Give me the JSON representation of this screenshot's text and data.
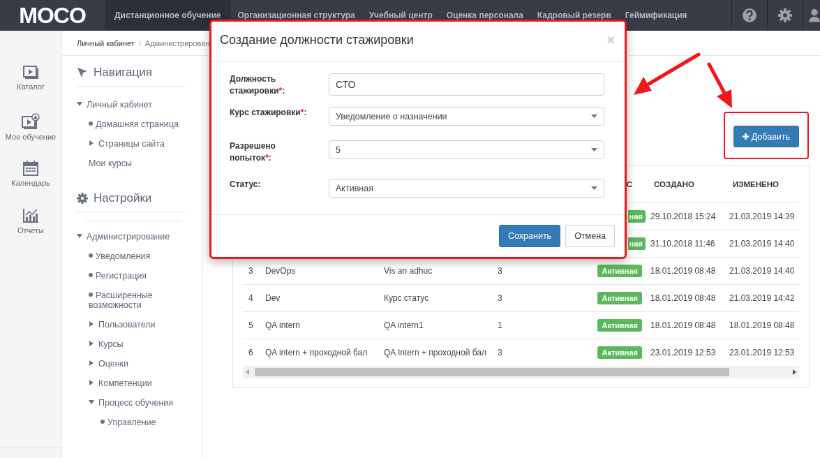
{
  "logo": "MOCO",
  "top_menu": [
    {
      "label": "Дистанционное обучение",
      "selected": true
    },
    {
      "label": "Организационная структура",
      "selected": false
    },
    {
      "label": "Учебный центр",
      "selected": false
    },
    {
      "label": "Оценка персонала",
      "selected": false
    },
    {
      "label": "Кадровый резерв",
      "selected": false
    },
    {
      "label": "Геймификация",
      "selected": false
    }
  ],
  "rail": [
    {
      "label": "Каталог"
    },
    {
      "label": "Мое обучение"
    },
    {
      "label": "Календарь"
    },
    {
      "label": "Отчеты"
    }
  ],
  "breadcrumb": [
    {
      "label": "Личный кабинет"
    },
    {
      "separator": "/",
      "label": "Администрирован"
    }
  ],
  "sections": [
    {
      "title": "Навигация",
      "items": [
        {
          "label": "Личный кабинет",
          "kind": "folder",
          "expanded": true,
          "children": [
            {
              "label": "Домашняя страница",
              "kind": "leaf"
            },
            {
              "label": "Страницы сайта",
              "kind": "folder",
              "expanded": false
            }
          ]
        },
        {
          "label": "Мои курсы",
          "kind": "plain"
        }
      ]
    },
    {
      "title": "Настройки",
      "items": [
        {
          "label": "Администрирование",
          "kind": "folder",
          "expanded": true,
          "children": [
            {
              "label": "Уведомления",
              "kind": "leaf"
            },
            {
              "label": "Регистрация",
              "kind": "leaf"
            },
            {
              "label": "Расширенные возможности",
              "kind": "leaf"
            },
            {
              "label": "Пользователи",
              "kind": "folder",
              "expanded": false
            },
            {
              "label": "Курсы",
              "kind": "folder",
              "expanded": false
            },
            {
              "label": "Оценки",
              "kind": "folder",
              "expanded": false
            },
            {
              "label": "Компетенции",
              "kind": "folder",
              "expanded": false
            },
            {
              "label": "Процесс обучения",
              "kind": "folder",
              "expanded": true,
              "children": [
                {
                  "label": "Управление",
                  "kind": "leaf"
                }
              ]
            }
          ]
        }
      ]
    }
  ],
  "add_button": "Добавить",
  "table": {
    "header": {
      "status": "С",
      "created": "СОЗДАНО",
      "changed": "ИЗМЕНЕНО"
    },
    "rows": [
      {
        "status": "ная",
        "created": "29.10.2018 15:24",
        "changed": "21.03.2019 14:39"
      },
      {
        "status": "ная",
        "created": "31.10.2018 11:46",
        "changed": "21.03.2019 14:40"
      },
      {
        "num": "3",
        "name": "DevOps",
        "course": "Vis an adhuc",
        "attempts": "3",
        "status": "Активная",
        "created": "18.01.2019 08:48",
        "changed": "21.03.2019 14:40"
      },
      {
        "num": "4",
        "name": "Dev",
        "course": "Курс статус",
        "attempts": "3",
        "status": "Активная",
        "created": "18.01.2019 08:48",
        "changed": "21.03.2019 14:42"
      },
      {
        "num": "5",
        "name": "QA intern",
        "course": "QA intern1",
        "attempts": "1",
        "status": "Активная",
        "created": "18.01.2019 08:48",
        "changed": "18.01.2019 08:48"
      },
      {
        "num": "6",
        "name": "QA intern + проходной бал",
        "course": "QA Intern + проходной бал",
        "attempts": "3",
        "status": "Активная",
        "created": "23.01.2019 12:53",
        "changed": "23.01.2019 12:53"
      }
    ]
  },
  "dialog": {
    "title": "Создание должности стажировки",
    "close": "×",
    "fields": [
      {
        "label": "Должность стажировки",
        "mark": "*",
        "colon": ":",
        "kind": "input",
        "value": "СТО"
      },
      {
        "label": "Курс стажировки",
        "mark": "*",
        "colon": ":",
        "kind": "select",
        "value": "Уведомление о назначении"
      },
      {
        "label": "Разрешено попыток",
        "mark": "*",
        "colon": ":",
        "kind": "select",
        "value": "5"
      },
      {
        "label": "Статус:",
        "kind": "select",
        "value": "Активная"
      }
    ],
    "buttons": [
      {
        "label": "Сохранить",
        "kind": "primary"
      },
      {
        "label": "Отмена",
        "kind": "default"
      }
    ]
  }
}
